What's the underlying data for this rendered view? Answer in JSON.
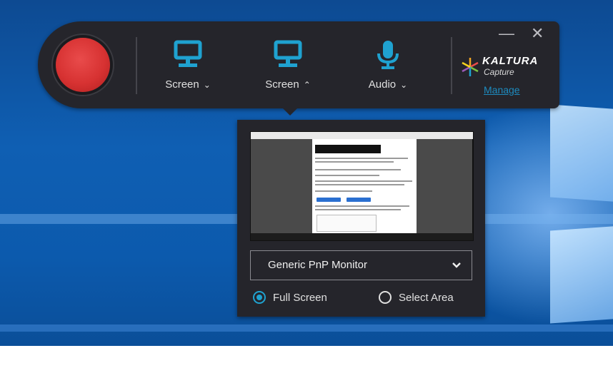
{
  "toolbar": {
    "tools": [
      {
        "label": "Screen",
        "icon": "monitor-icon",
        "caret": "chevron-down"
      },
      {
        "label": "Screen",
        "icon": "monitor-icon",
        "caret": "chevron-up"
      },
      {
        "label": "Audio",
        "icon": "microphone-icon",
        "caret": "chevron-down"
      }
    ],
    "caret_down": "⌄",
    "caret_up": "⌃",
    "minimize_glyph": "—",
    "close_glyph": "✕",
    "logo": {
      "name": "KALTURA",
      "sub": "Capture"
    },
    "manage_label": "Manage"
  },
  "screen_panel": {
    "monitor_select": {
      "value": "Generic PnP Monitor"
    },
    "options": [
      {
        "label": "Full Screen",
        "selected": true
      },
      {
        "label": "Select Area",
        "selected": false
      }
    ]
  },
  "colors": {
    "accent": "#1fa2d0",
    "record": "#d73232",
    "toolbar_bg": "#25252b",
    "link": "#1d8bbf"
  }
}
